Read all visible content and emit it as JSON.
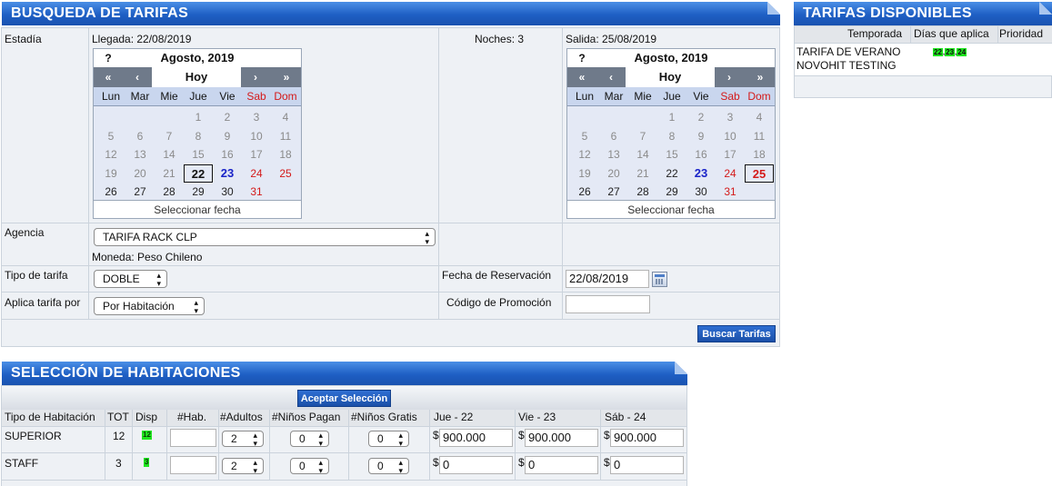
{
  "search": {
    "header": "BUSQUEDA DE TARIFAS",
    "estadia_label": "Estadía",
    "llegada": "Llegada: 22/08/2019",
    "noches": "Noches: 3",
    "salida": "Salida: 25/08/2019",
    "agencia_label": "Agencia",
    "agencia_value": "TARIFA RACK CLP",
    "moneda": "Moneda: Peso Chileno",
    "tipo_tarifa_label": "Tipo de tarifa",
    "tipo_tarifa_value": "DOBLE",
    "aplica_label": "Aplica tarifa por",
    "aplica_value": "Por Habitación",
    "fecha_reserva_label": "Fecha de Reservación",
    "fecha_reserva_value": "22/08/2019",
    "promo_label": "Código de Promoción",
    "promo_value": "",
    "buscar_button": "Buscar Tarifas"
  },
  "calendar": {
    "help": "?",
    "month_title": "Agosto, 2019",
    "nav": {
      "prev_year": "«",
      "prev_month": "‹",
      "today": "Hoy",
      "next_month": "›",
      "next_year": "»"
    },
    "weekdays": [
      "Lun",
      "Mar",
      "Mie",
      "Jue",
      "Vie",
      "Sab",
      "Dom"
    ],
    "weeks": [
      [
        "",
        "",
        "",
        "1",
        "2",
        "3",
        "4"
      ],
      [
        "5",
        "6",
        "7",
        "8",
        "9",
        "10",
        "11"
      ],
      [
        "12",
        "13",
        "14",
        "15",
        "16",
        "17",
        "18"
      ],
      [
        "19",
        "20",
        "21",
        "22",
        "23",
        "24",
        "25"
      ],
      [
        "26",
        "27",
        "28",
        "29",
        "30",
        "31",
        ""
      ]
    ],
    "footer": "Seleccionar fecha"
  },
  "available": {
    "header": "TARIFAS DISPONIBLES",
    "columns": [
      "Temporada",
      "Días que aplica",
      "Prioridad"
    ],
    "rows": [
      {
        "temporada_1": "TARIFA DE VERANO",
        "temporada_2": "NOVOHIT TESTING",
        "dias": [
          "22",
          "23",
          "24"
        ],
        "prioridad": ""
      }
    ]
  },
  "rooms": {
    "header": "SELECCIÓN DE HABITACIONES",
    "accept_button": "Aceptar Selección",
    "columns": [
      "Tipo de Habitación",
      "TOT",
      "Disp",
      "#Hab.",
      "#Adultos",
      "#Niños Pagan",
      "#Niños Gratis",
      "Jue - 22",
      "Vie - 23",
      "Sáb - 24"
    ],
    "currency_symbol": "$",
    "rows": [
      {
        "tipo": "SUPERIOR",
        "tot": "12",
        "disp": "12",
        "hab": "",
        "adultos": "2",
        "ninos_pagan": "0",
        "ninos_gratis": "0",
        "prices": [
          "900.000",
          "900.000",
          "900.000"
        ]
      },
      {
        "tipo": "STAFF",
        "tot": "3",
        "disp": "3",
        "hab": "",
        "adultos": "2",
        "ninos_pagan": "0",
        "ninos_gratis": "0",
        "prices": [
          "0",
          "0",
          "0"
        ]
      }
    ]
  },
  "colors": {
    "header_blue": "#1e5fc4",
    "weekend_red": "#d41a1a",
    "badge_green": "#1ee51e"
  }
}
